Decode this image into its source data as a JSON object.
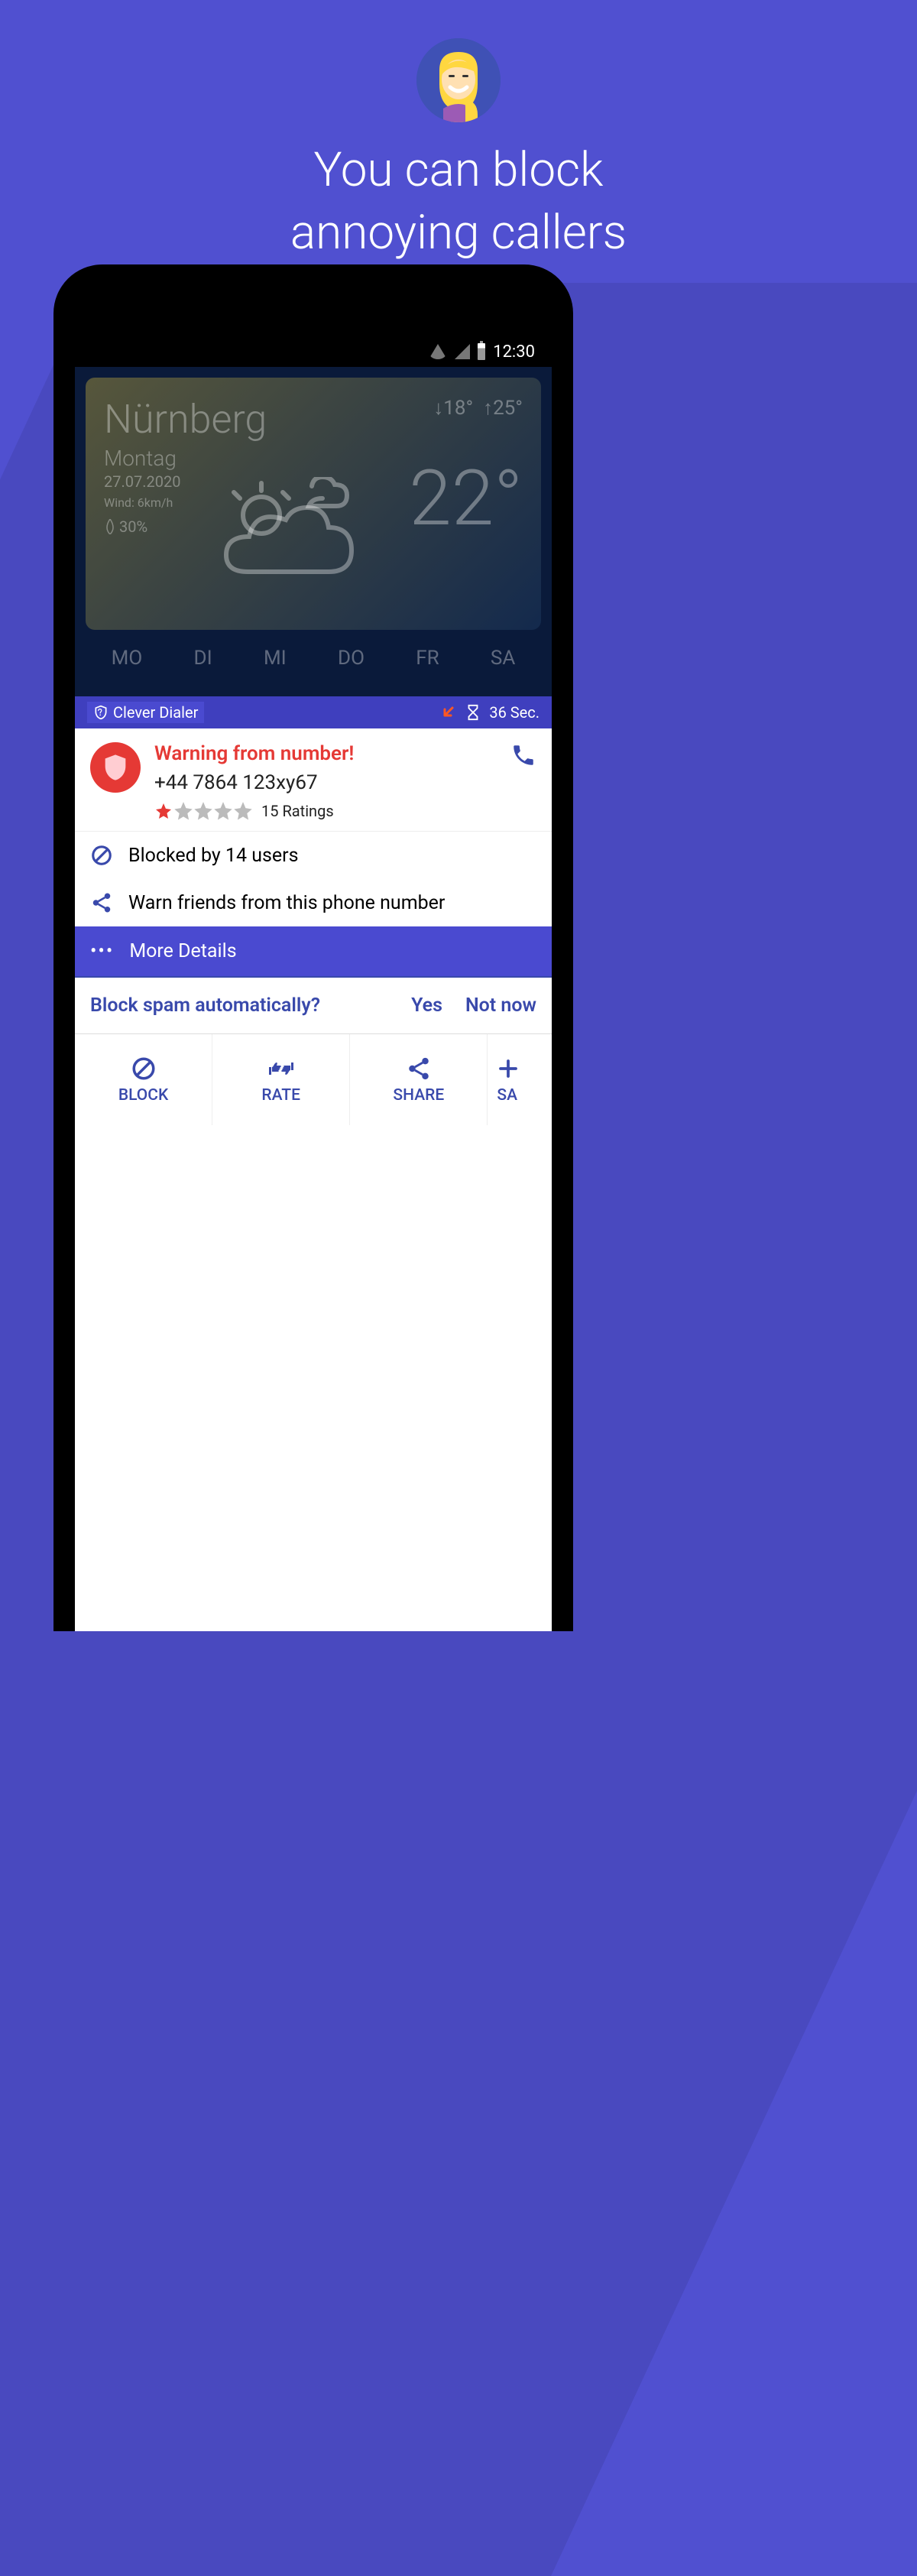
{
  "hero": {
    "title_line1": "You can block",
    "title_line2": "annoying callers"
  },
  "statusbar": {
    "time": "12:30"
  },
  "weather": {
    "city": "Nürnberg",
    "day": "Montag",
    "date": "27.07.2020",
    "wind": "Wind: 6km/h",
    "humidity": "30%",
    "low": "18°",
    "high": "25°",
    "current": "22°",
    "forecast": [
      "MO",
      "DI",
      "MI",
      "DO",
      "FR",
      "SA"
    ]
  },
  "dialer": {
    "brand": "Clever Dialer",
    "timer": "36 Sec.",
    "warning_title": "Warning from number!",
    "phone_number": "+44 7864 123xy67",
    "rating_stars": 1,
    "rating_max": 5,
    "ratings_label": "15 Ratings",
    "blocked_text": "Blocked by 14 users",
    "warn_friends_text": "Warn friends from this phone number",
    "more_details": "More Details",
    "auto_question": "Block spam automatically?",
    "auto_yes": "Yes",
    "auto_no": "Not now",
    "actions": {
      "block": "BLOCK",
      "rate": "RATE",
      "share": "SHARE",
      "save": "SA"
    }
  }
}
